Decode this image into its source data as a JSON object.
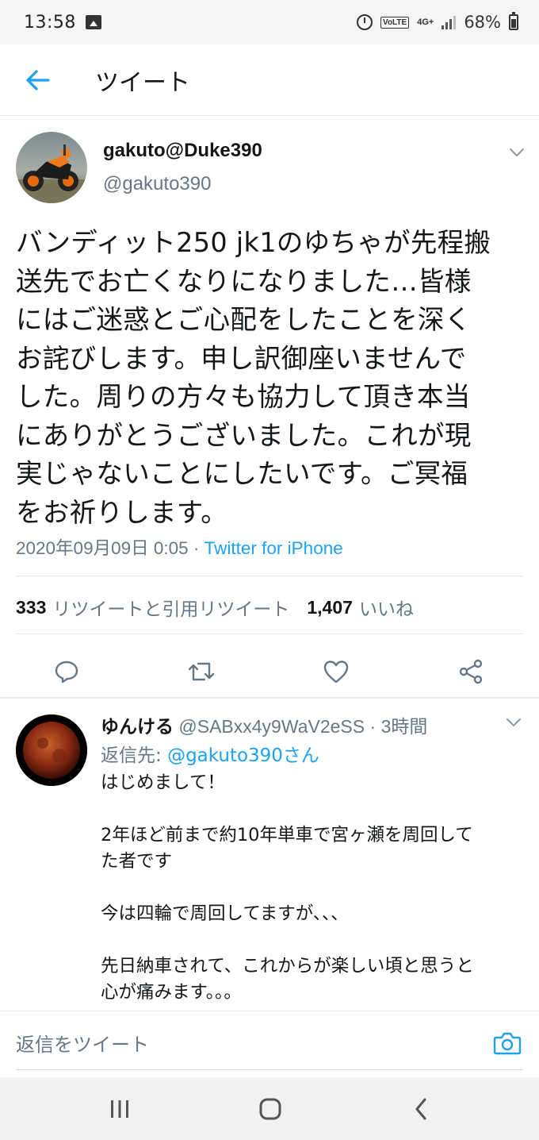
{
  "status_bar": {
    "time": "13:58",
    "gallery_icon": "image-icon",
    "alarm_icon": "alarm-icon",
    "volte": "VoLTE",
    "network": "4G+",
    "battery_percent": "68%"
  },
  "header": {
    "back_icon": "back-arrow-icon",
    "title": "ツイート"
  },
  "tweet": {
    "author_name": "gakuto@Duke390",
    "author_handle": "@gakuto390",
    "text": "バンディット250 jk1のゆちゃが先程搬\n送先でお亡くなりになりました…皆様\nにはご迷惑とご心配をしたことを深く\nお詫びします。申し訳御座いませんで\nした。周りの方々も協力して頂き本当\nにありがとうございました。これが現\n実じゃないことにしたいです。ご冥福\nをお祈りします。",
    "datetime": "2020年09月09日 0:05",
    "separator": " · ",
    "source": "Twitter for iPhone",
    "retweet_count": "333",
    "retweet_label": "リツイートと引用リツイート",
    "like_count": "1,407",
    "like_label": "いいね",
    "actions": [
      "reply-icon",
      "retweet-icon",
      "like-icon",
      "share-icon"
    ]
  },
  "reply": {
    "name": "ゆんける",
    "handle": "@SABxx4y9WaV2eSS",
    "separator": " · ",
    "time": "3時間",
    "reply_to_label": "返信先: ",
    "reply_to_mention": "@gakuto390さん",
    "text": "はじめまして！\n\n2年ほど前まで約10年単車で宮ヶ瀬を周回して\nた者です\n\n今は四輪で周回してますが、、、\n\n先日納車されて、これからが楽しい頃と思うと\n心が痛みます。。。"
  },
  "compose": {
    "placeholder": "返信をツイート",
    "camera_icon": "camera-icon"
  },
  "navbar": {
    "buttons": [
      "recent-apps-icon",
      "home-icon",
      "back-icon"
    ]
  },
  "colors": {
    "accent": "#1da1f2",
    "secondary_text": "#657786",
    "divider": "#e1e8ed"
  }
}
